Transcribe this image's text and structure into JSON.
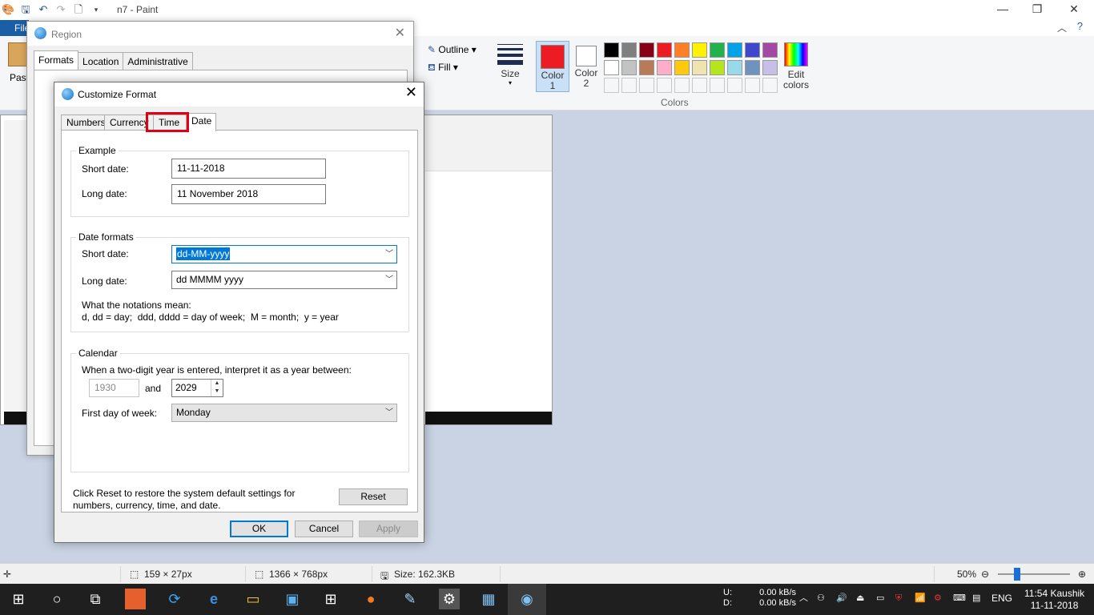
{
  "paint": {
    "title": "n7 - Paint",
    "file_tab": "File",
    "ribbon": {
      "paste_label": "Paste",
      "outline_label": "Outline",
      "fill_label": "Fill",
      "size_label": "Size",
      "color1_label": "Color 1",
      "color2_label": "Color 2",
      "edit_colors_label": "Edit colors",
      "colors_group": "Colors",
      "color1_value": "#ed1c24",
      "palette": [
        "#000000",
        "#7f7f7f",
        "#880015",
        "#ed1c24",
        "#ff7f27",
        "#fff200",
        "#22b14c",
        "#00a2e8",
        "#3f48cc",
        "#a349a4",
        "#ffffff",
        "#c3c3c3",
        "#b97a57",
        "#ffaec9",
        "#ffc90e",
        "#efe4b0",
        "#b5e61d",
        "#99d9ea",
        "#7092be",
        "#c8bfe7"
      ]
    },
    "status": {
      "selection_size": "159 × 27px",
      "image_size": "1366 × 768px",
      "file_size": "Size: 162.3KB",
      "zoom": "50%"
    }
  },
  "region": {
    "title": "Region",
    "tabs": [
      "Formats",
      "Location",
      "Administrative"
    ]
  },
  "dialog": {
    "title": "Customize Format",
    "tabs": [
      "Numbers",
      "Currency",
      "Time",
      "Date"
    ],
    "example": {
      "legend": "Example",
      "short_label": "Short date:",
      "short_value": "11-11-2018",
      "long_label": "Long date:",
      "long_value": "11 November 2018"
    },
    "formats": {
      "legend": "Date formats",
      "short_label": "Short date:",
      "short_value": "dd-MM-yyyy",
      "long_label": "Long date:",
      "long_value": "dd MMMM yyyy",
      "notation_title": "What the notations mean:",
      "notation_text": "d, dd = day;  ddd, dddd = day of week;  M = month;  y = year"
    },
    "calendar": {
      "legend": "Calendar",
      "two_digit_text": "When a two-digit year is entered, interpret it as a year between:",
      "year_from": "1930",
      "and_label": "and",
      "year_to": "2029",
      "first_day_label": "First day of week:",
      "first_day_value": "Monday"
    },
    "reset_text": "Click Reset to restore the system default settings for numbers, currency, time, and date.",
    "reset_label": "Reset",
    "ok_label": "OK",
    "cancel_label": "Cancel",
    "apply_label": "Apply"
  },
  "taskbar": {
    "net_up_label": "U:",
    "net_down_label": "D:",
    "net_up": "0.00 kB/s",
    "net_down": "0.00 kB/s",
    "lang": "ENG",
    "time_user": "11:54 Kaushik",
    "date": "11-11-2018"
  }
}
